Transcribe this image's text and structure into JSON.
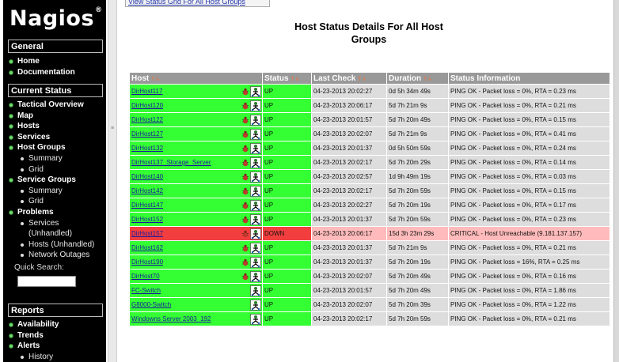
{
  "sidebar": {
    "logo": "Nagios",
    "logo_mark": "®",
    "sections": {
      "general": "General",
      "current_status": "Current Status",
      "reports": "Reports"
    },
    "general_items": [
      "Home",
      "Documentation"
    ],
    "current_status_items": [
      {
        "label": "Tactical Overview",
        "subs": []
      },
      {
        "label": "Map",
        "subs": []
      },
      {
        "label": "Hosts",
        "subs": []
      },
      {
        "label": "Services",
        "subs": []
      },
      {
        "label": "Host Groups",
        "subs": [
          "Summary",
          "Grid"
        ]
      },
      {
        "label": "Service Groups",
        "subs": [
          "Summary",
          "Grid"
        ]
      },
      {
        "label": "Problems",
        "subs": [
          "Services",
          "(Unhandled)",
          "Hosts (Unhandled)",
          "Network Outages"
        ]
      }
    ],
    "quick_search_label": "Quick Search:",
    "quick_search_value": "",
    "report_items": [
      "Availability",
      "Trends",
      "Alerts"
    ],
    "report_subs": [
      "History"
    ]
  },
  "main": {
    "top_link": "View Status Grid For All Host Groups",
    "title": "Host Status Details For All Host Groups",
    "columns": [
      "Host",
      "Status",
      "Last Check",
      "Duration",
      "Status Information"
    ],
    "rows": [
      {
        "host": "DirHost117",
        "status": "UP",
        "last_check": "04-23-2013 20:02:27",
        "duration": "0d 5h 34m 49s",
        "info": "PING OK - Packet loss = 0%, RTA = 0.23 ms",
        "state": "up",
        "bug": true
      },
      {
        "host": "DirHost120",
        "status": "UP",
        "last_check": "04-23-2013 20:06:17",
        "duration": "5d 7h 21m 9s",
        "info": "PING OK - Packet loss = 0%, RTA = 0.21 ms",
        "state": "up",
        "bug": true
      },
      {
        "host": "DirHost122",
        "status": "UP",
        "last_check": "04-23-2013 20:01:57",
        "duration": "5d 7h 20m 49s",
        "info": "PING OK - Packet loss = 0%, RTA = 0.15 ms",
        "state": "up",
        "bug": true
      },
      {
        "host": "DirHost127",
        "status": "UP",
        "last_check": "04-23-2013 20:02:07",
        "duration": "5d 7h 21m 9s",
        "info": "PING OK - Packet loss = 0%, RTA = 0.41 ms",
        "state": "up",
        "bug": true
      },
      {
        "host": "DirHost132",
        "status": "UP",
        "last_check": "04-23-2013 20:01:37",
        "duration": "0d 5h 50m 59s",
        "info": "PING OK - Packet loss = 0%, RTA = 0.24 ms",
        "state": "up",
        "bug": true
      },
      {
        "host": "DirHost137_Storage_Server",
        "status": "UP",
        "last_check": "04-23-2013 20:02:17",
        "duration": "5d 7h 20m 29s",
        "info": "PING OK - Packet loss = 0%, RTA = 0.14 ms",
        "state": "up",
        "bug": true
      },
      {
        "host": "DirHost140",
        "status": "UP",
        "last_check": "04-23-2013 20:02:57",
        "duration": "1d 9h 49m 19s",
        "info": "PING OK - Packet loss = 0%, RTA = 0.03 ms",
        "state": "up",
        "bug": true
      },
      {
        "host": "DirHost142",
        "status": "UP",
        "last_check": "04-23-2013 20:02:17",
        "duration": "5d 7h 20m 59s",
        "info": "PING OK - Packet loss = 0%, RTA = 0.15 ms",
        "state": "up",
        "bug": true
      },
      {
        "host": "DirHost147",
        "status": "UP",
        "last_check": "04-23-2013 20:02:27",
        "duration": "5d 7h 20m 19s",
        "info": "PING OK - Packet loss = 0%, RTA = 0.17 ms",
        "state": "up",
        "bug": true
      },
      {
        "host": "DirHost152",
        "status": "UP",
        "last_check": "04-23-2013 20:01:37",
        "duration": "5d 7h 20m 59s",
        "info": "PING OK - Packet loss = 0%, RTA = 0.23 ms",
        "state": "up",
        "bug": true
      },
      {
        "host": "DirHost157",
        "status": "DOWN",
        "last_check": "04-23-2013 20:06:17",
        "duration": "15d 3h 23m 29s",
        "info": "CRITICAL - Host Unreachable (9.181.137.157)",
        "state": "down",
        "bug": true
      },
      {
        "host": "DirHost162",
        "status": "UP",
        "last_check": "04-23-2013 20:01:37",
        "duration": "5d 7h 21m 9s",
        "info": "PING OK - Packet loss = 0%, RTA = 0.21 ms",
        "state": "up",
        "bug": true
      },
      {
        "host": "DirHost190",
        "status": "UP",
        "last_check": "04-23-2013 20:01:37",
        "duration": "5d 7h 20m 19s",
        "info": "PING OK - Packet loss = 16%, RTA = 0.25 ms",
        "state": "up",
        "bug": true
      },
      {
        "host": "DirHost70",
        "status": "UP",
        "last_check": "04-23-2013 20:02:07",
        "duration": "5d 7h 20m 49s",
        "info": "PING OK - Packet loss = 0%, RTA = 0.16 ms",
        "state": "up",
        "bug": true
      },
      {
        "host": "FC-Switch",
        "status": "UP",
        "last_check": "04-23-2013 20:01:57",
        "duration": "5d 7h 20m 49s",
        "info": "PING OK - Packet loss = 0%, RTA = 1.86 ms",
        "state": "up",
        "bug": false
      },
      {
        "host": "G8000-Switch",
        "status": "UP",
        "last_check": "04-23-2013 20:02:07",
        "duration": "5d 7h 20m 39s",
        "info": "PING OK - Packet loss = 0%, RTA = 1.22 ms",
        "state": "up",
        "bug": false
      },
      {
        "host": "Windowns Server 2003_192",
        "status": "UP",
        "last_check": "04-23-2013 20:02:17",
        "duration": "5d 7h 20m 59s",
        "info": "PING OK - Packet loss = 0%, RTA = 0.21 ms",
        "state": "up",
        "bug": false
      }
    ]
  },
  "colors": {
    "up": "#33ff33",
    "down": "#f23e3e",
    "down_light": "#ffbbbb",
    "header": "#999999",
    "sidebar": "#000000"
  },
  "icons": {
    "row_icons": [
      "bug-icon",
      "network-host-icon"
    ],
    "nav_bullet": "green-dot-icon"
  }
}
